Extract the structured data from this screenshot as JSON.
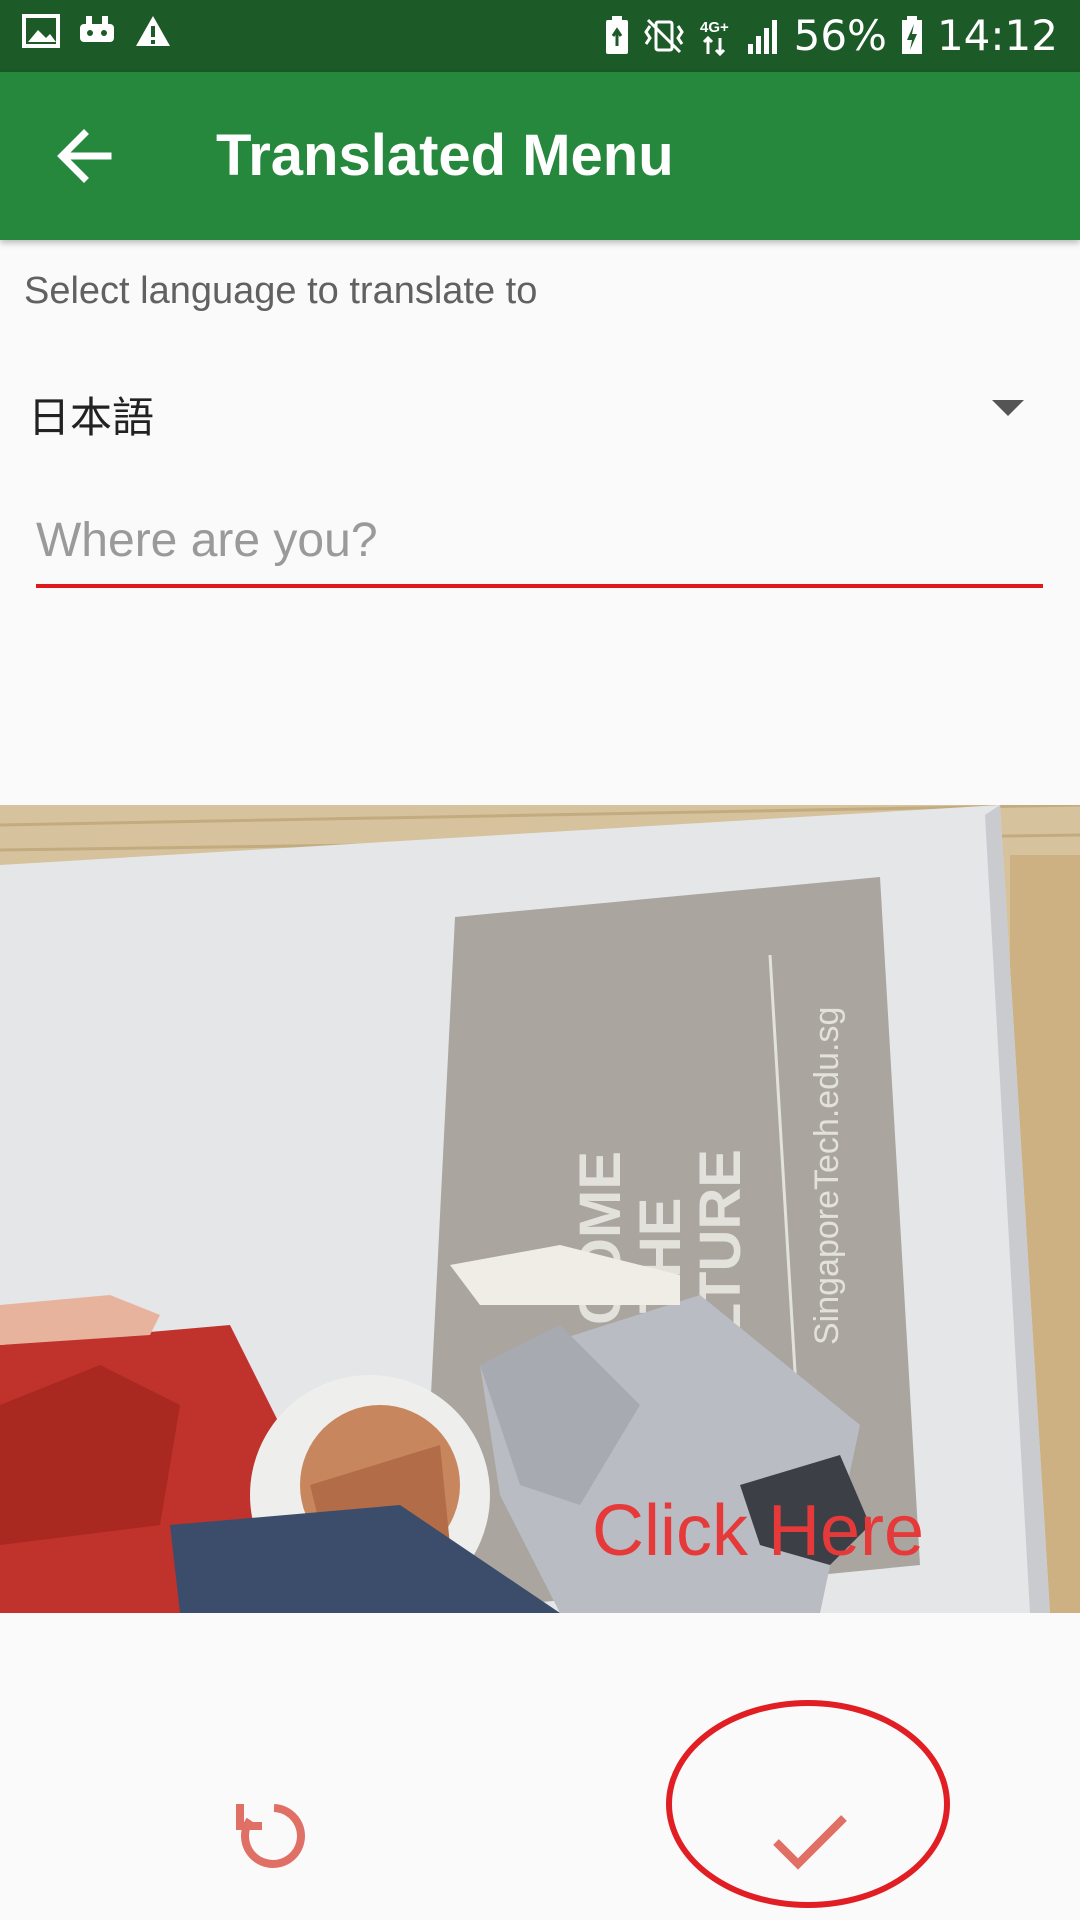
{
  "status_bar": {
    "icons_left": [
      "image-icon",
      "game-icon",
      "warning-icon"
    ],
    "icons_right": [
      "battery-saver-icon",
      "vibrate-icon",
      "network-4g-icon",
      "signal-icon"
    ],
    "battery": "56%",
    "battery_icon": "battery-charging-icon",
    "time": "14:12"
  },
  "app_bar": {
    "title": "Translated Menu",
    "back_icon": "arrow-left-icon",
    "color": "#26883c"
  },
  "language": {
    "label": "Select language to translate to",
    "selected": "日本語"
  },
  "query": {
    "placeholder": "Where are you?",
    "value": ""
  },
  "photo": {
    "poster_lines": [
      "COME",
      "JOIN THE",
      "DO CULTURE"
    ],
    "poster_url": "SingaporeTech.edu.sg"
  },
  "annotation": {
    "click_text": "Click Here",
    "color": "#e01e24"
  },
  "actions": {
    "retry_icon": "refresh-icon",
    "confirm_icon": "check-icon"
  }
}
